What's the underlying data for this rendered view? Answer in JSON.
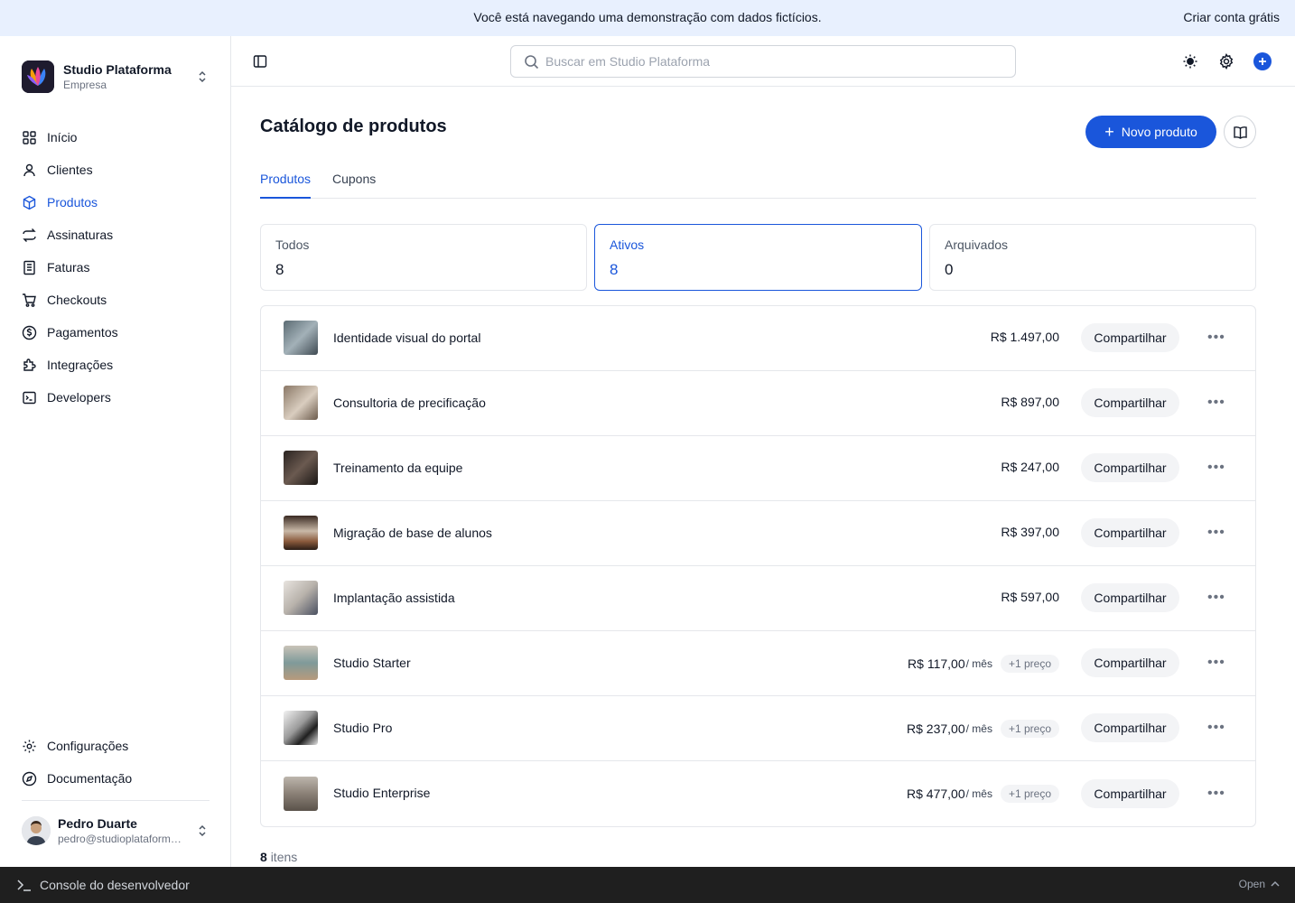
{
  "banner": {
    "message": "Você está navegando uma demonstração com dados fictícios.",
    "cta": "Criar conta grátis"
  },
  "org": {
    "name": "Studio Plataforma",
    "type": "Empresa"
  },
  "nav": {
    "items": [
      {
        "label": "Início",
        "icon": "grid-icon"
      },
      {
        "label": "Clientes",
        "icon": "user-icon"
      },
      {
        "label": "Produtos",
        "icon": "box-icon"
      },
      {
        "label": "Assinaturas",
        "icon": "repeat-icon"
      },
      {
        "label": "Faturas",
        "icon": "receipt-icon"
      },
      {
        "label": "Checkouts",
        "icon": "cart-icon"
      },
      {
        "label": "Pagamentos",
        "icon": "dollar-circle-icon"
      },
      {
        "label": "Integrações",
        "icon": "puzzle-icon"
      },
      {
        "label": "Developers",
        "icon": "terminal-icon"
      }
    ],
    "bottom": [
      {
        "label": "Configurações",
        "icon": "gear-icon"
      },
      {
        "label": "Documentação",
        "icon": "compass-icon"
      }
    ]
  },
  "user": {
    "name": "Pedro Duarte",
    "email": "pedro@studioplataforma.com"
  },
  "search": {
    "placeholder": "Buscar em Studio Plataforma"
  },
  "page": {
    "title": "Catálogo de produtos",
    "new_button": "Novo produto"
  },
  "tabs": [
    "Produtos",
    "Cupons"
  ],
  "stats": [
    {
      "label": "Todos",
      "value": "8"
    },
    {
      "label": "Ativos",
      "value": "8"
    },
    {
      "label": "Arquivados",
      "value": "0"
    }
  ],
  "products": [
    {
      "name": "Identidade visual do portal",
      "price": "R$ 1.497,00",
      "per": "",
      "badge": ""
    },
    {
      "name": "Consultoria de precificação",
      "price": "R$ 897,00",
      "per": "",
      "badge": ""
    },
    {
      "name": "Treinamento da equipe",
      "price": "R$ 247,00",
      "per": "",
      "badge": ""
    },
    {
      "name": "Migração de base de alunos",
      "price": "R$ 397,00",
      "per": "",
      "badge": ""
    },
    {
      "name": "Implantação assistida",
      "price": "R$ 597,00",
      "per": "",
      "badge": ""
    },
    {
      "name": "Studio Starter",
      "price": "R$ 117,00",
      "per": "/ mês",
      "badge": "+1 preço"
    },
    {
      "name": "Studio Pro",
      "price": "R$ 237,00",
      "per": "/ mês",
      "badge": "+1 preço"
    },
    {
      "name": "Studio Enterprise",
      "price": "R$ 477,00",
      "per": "/ mês",
      "badge": "+1 preço"
    }
  ],
  "share_label": "Compartilhar",
  "footer": {
    "count": "8",
    "count_suffix": "itens"
  },
  "console": {
    "label": "Console do desenvolvedor",
    "open": "Open"
  },
  "colors": {
    "accent": "#1a56db",
    "banner_bg": "#e8f0fe",
    "console_bg": "#1f1f1f"
  }
}
